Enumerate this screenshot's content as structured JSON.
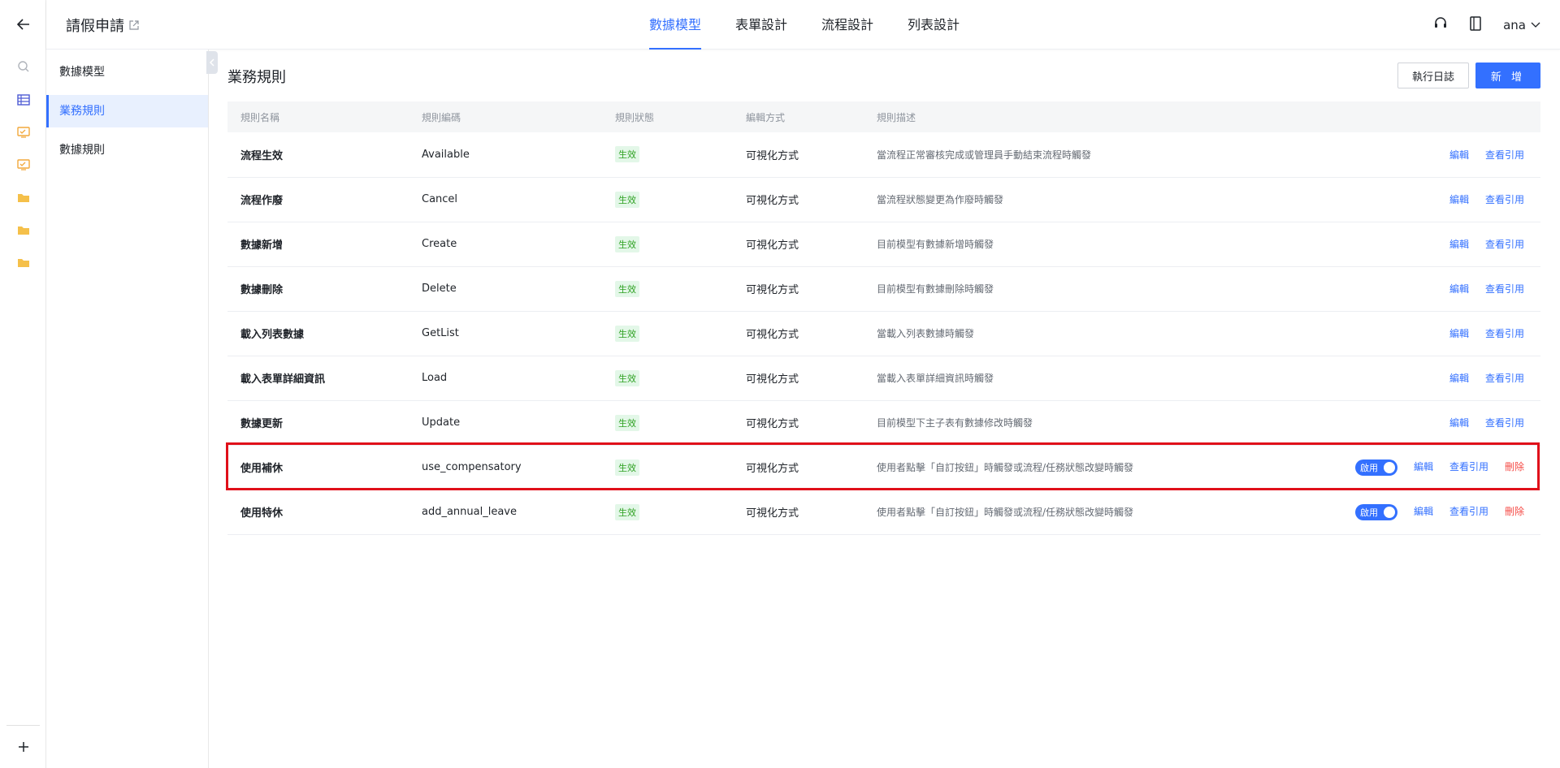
{
  "app": {
    "title": "請假申請"
  },
  "nav": {
    "tabs": [
      {
        "label": "數據模型"
      },
      {
        "label": "表單設計"
      },
      {
        "label": "流程設計"
      },
      {
        "label": "列表設計"
      }
    ]
  },
  "user": {
    "name": "ana"
  },
  "sidebar": {
    "items": [
      {
        "label": "數據模型"
      },
      {
        "label": "業務規則"
      },
      {
        "label": "數據規則"
      }
    ]
  },
  "page": {
    "title": "業務規則",
    "log_button": "執行日誌",
    "new_button": "新 增"
  },
  "table": {
    "headers": [
      "規則名稱",
      "規則編碼",
      "規則狀態",
      "編輯方式",
      "規則描述"
    ],
    "rows": [
      {
        "name": "流程生效",
        "code": "Available",
        "status": "生效",
        "mode": "可視化方式",
        "desc": "當流程正常審核完成或管理員手動結束流程時觸發"
      },
      {
        "name": "流程作廢",
        "code": "Cancel",
        "status": "生效",
        "mode": "可視化方式",
        "desc": "當流程狀態變更為作廢時觸發"
      },
      {
        "name": "數據新增",
        "code": "Create",
        "status": "生效",
        "mode": "可視化方式",
        "desc": "目前模型有數據新增時觸發"
      },
      {
        "name": "數據刪除",
        "code": "Delete",
        "status": "生效",
        "mode": "可視化方式",
        "desc": "目前模型有數據刪除時觸發"
      },
      {
        "name": "載入列表數據",
        "code": "GetList",
        "status": "生效",
        "mode": "可視化方式",
        "desc": "當載入列表數據時觸發"
      },
      {
        "name": "載入表單詳細資訊",
        "code": "Load",
        "status": "生效",
        "mode": "可視化方式",
        "desc": "當載入表單詳細資訊時觸發"
      },
      {
        "name": "數據更新",
        "code": "Update",
        "status": "生效",
        "mode": "可視化方式",
        "desc": "目前模型下主子表有數據修改時觸發"
      },
      {
        "name": "使用補休",
        "code": "use_compensatory",
        "status": "生效",
        "mode": "可視化方式",
        "desc": "使用者點擊「自訂按鈕」時觸發或流程/任務狀態改變時觸發"
      },
      {
        "name": "使用特休",
        "code": "add_annual_leave",
        "status": "生效",
        "mode": "可視化方式",
        "desc": "使用者點擊「自訂按鈕」時觸發或流程/任務狀態改變時觸發"
      }
    ],
    "actions": {
      "edit": "編輯",
      "refs": "查看引用",
      "delete": "刪除",
      "enable": "啟用"
    }
  },
  "colors": {
    "accent": "#3370ff",
    "success": "#2ea121",
    "danger": "#f54a45",
    "highlight": "#e0101a"
  }
}
